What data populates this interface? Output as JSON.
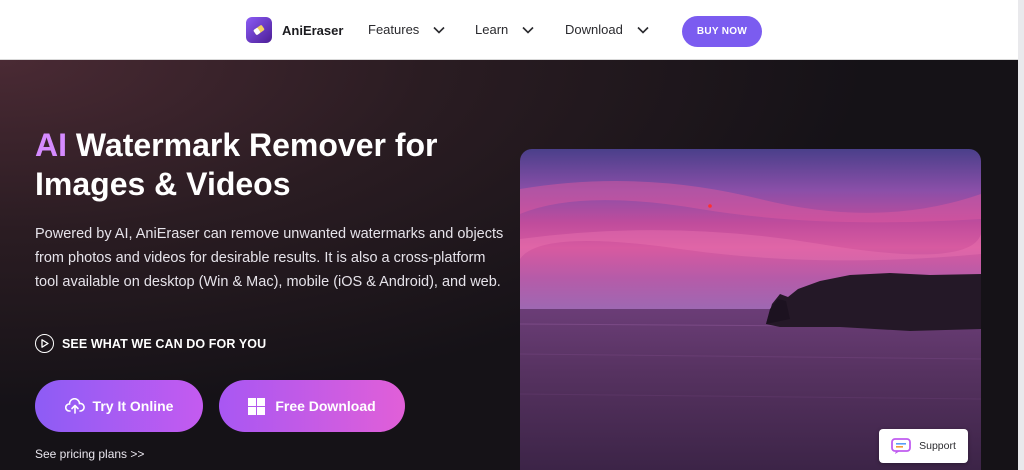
{
  "brand": {
    "name": "AniEraser",
    "logo_icon": "aneraser-logo-icon"
  },
  "nav": {
    "items": [
      {
        "label": "Features",
        "icon": "chevron-down-icon"
      },
      {
        "label": "Learn",
        "icon": "chevron-down-icon"
      },
      {
        "label": "Download",
        "icon": "chevron-down-icon"
      }
    ],
    "buy_label": "BUY NOW"
  },
  "hero": {
    "headline_accent": "AI",
    "headline_rest": " Watermark Remover for Images & Videos",
    "description": "Powered by AI, AniEraser can remove unwanted watermarks and objects from photos and videos for desirable results. It is also a cross-platform tool available on desktop (Win & Mac), mobile (iOS & Android), and web.",
    "see_link": "SEE WHAT WE CAN DO FOR YOU",
    "try_button": "Try It Online",
    "download_button": "Free Download",
    "pricing_link": "See pricing plans >>"
  },
  "support": {
    "label": "Support"
  },
  "colors": {
    "accent_purple": "#7b5cf0",
    "headline_accent": "#d58bff",
    "background": "#151217"
  }
}
